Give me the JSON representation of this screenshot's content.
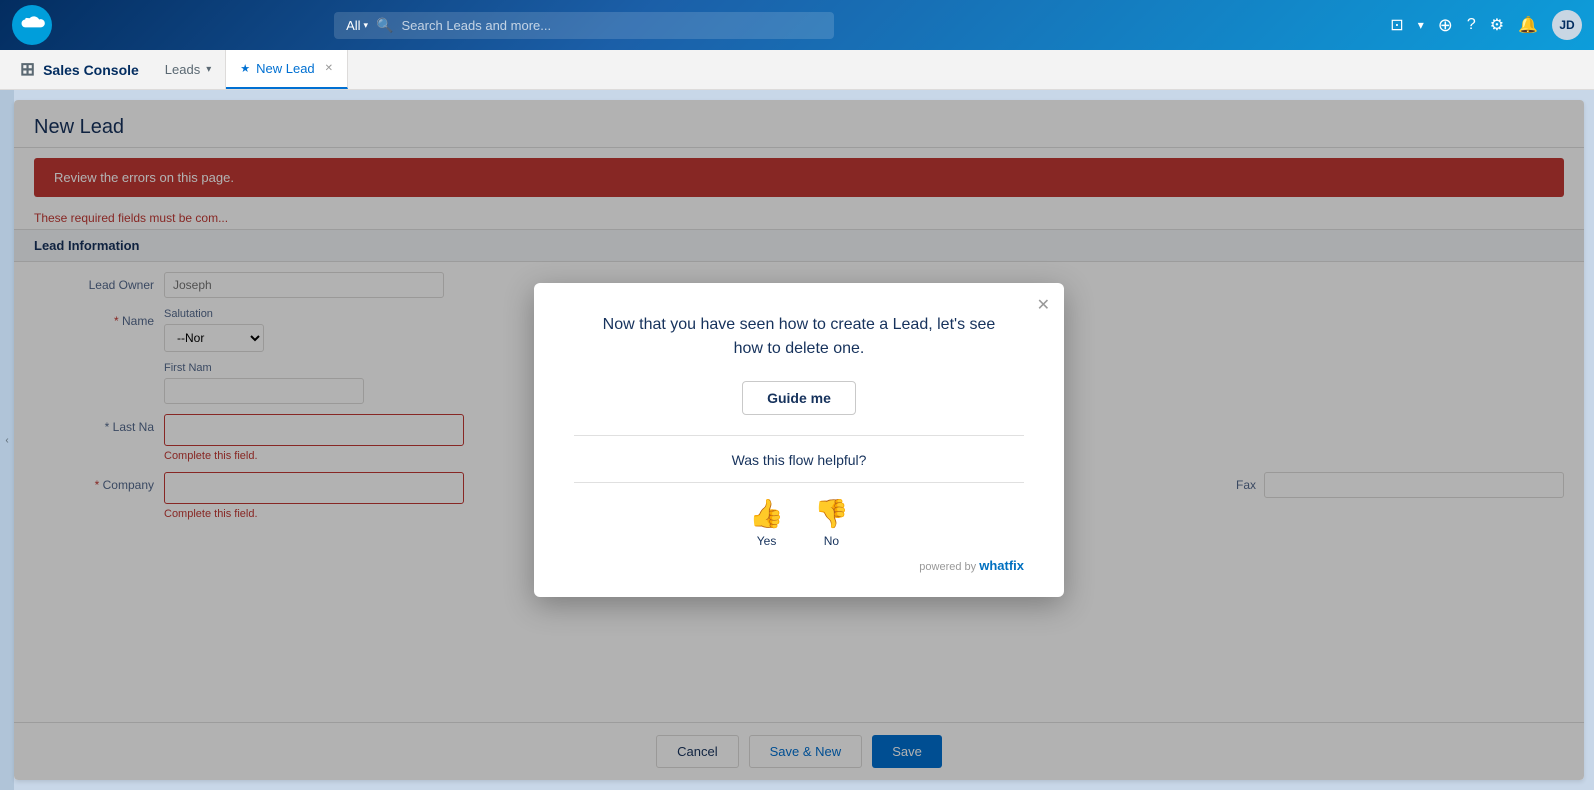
{
  "app": {
    "logo_alt": "Salesforce",
    "title": "Sales Console"
  },
  "nav": {
    "search_select_label": "All",
    "search_placeholder": "Search Leads and more...",
    "icons": [
      "grid",
      "add",
      "help",
      "settings",
      "notifications",
      "avatar"
    ]
  },
  "tabs": [
    {
      "label": "Leads",
      "active": false,
      "closeable": false
    },
    {
      "label": "New Lead",
      "active": true,
      "closeable": true
    }
  ],
  "form": {
    "title": "New Lead",
    "error_banner": "Review the errors on this page.",
    "required_note": "These required fields must be com...",
    "section": "Lead Information",
    "fields": {
      "lead_owner_label": "Lead Owner",
      "lead_owner_value": "Joseph",
      "name_label": "Name",
      "salutation_label": "Salutation",
      "salutation_value": "--Nor",
      "first_name_label": "First Nam",
      "last_name_label": "* Last Na",
      "complete_field_msg": "Complete this field.",
      "company_label": "Company",
      "fax_label": "Fax"
    }
  },
  "footer": {
    "cancel_label": "Cancel",
    "save_new_label": "Save & New",
    "save_label": "Save"
  },
  "modal": {
    "title_line1": "Now that you have seen how to create a Lead, let's see",
    "title_line2": "how to delete one.",
    "guide_btn_label": "Guide me",
    "feedback_question": "Was this flow helpful?",
    "yes_label": "Yes",
    "no_label": "No",
    "powered_by_text": "powered by",
    "brand_name": "whatfix"
  }
}
